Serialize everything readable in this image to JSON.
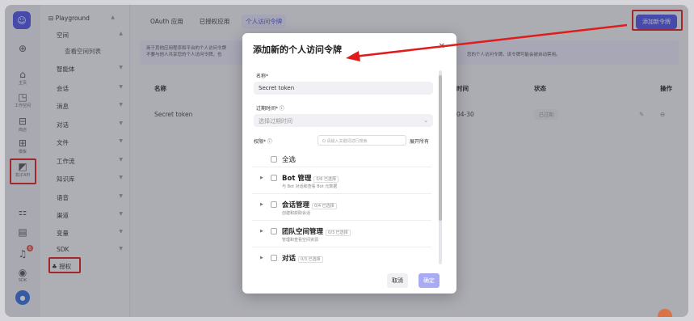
{
  "rail": {
    "items": [
      {
        "label": "主页"
      },
      {
        "label": "工作空间"
      },
      {
        "label": "商店"
      },
      {
        "label": "模板"
      },
      {
        "label": "扣子API"
      },
      {
        "label": "SDK"
      }
    ],
    "notification_count": "6"
  },
  "sidebar": {
    "title": "Playground",
    "items": [
      {
        "label": "空间"
      },
      {
        "label": "查看空间列表"
      },
      {
        "label": "智能体"
      },
      {
        "label": "会话"
      },
      {
        "label": "消息"
      },
      {
        "label": "对话"
      },
      {
        "label": "文件"
      },
      {
        "label": "工作流"
      },
      {
        "label": "知识库"
      },
      {
        "label": "语音"
      },
      {
        "label": "渠道"
      },
      {
        "label": "变量"
      },
      {
        "label": "SDK"
      },
      {
        "label": "授权"
      }
    ]
  },
  "main": {
    "tabs": [
      {
        "label": "OAuth 应用"
      },
      {
        "label": "已授权应用"
      },
      {
        "label": "个人访问令牌"
      }
    ],
    "add_button": "添加新令牌",
    "notice_line1": "用于其他应用程序和平台的个人访问令牌",
    "notice_line2": "不要与他人共享您的个人访问令牌，也",
    "notice_right": "您的个人访问令牌。该令牌可能会被自动禁用。",
    "columns": {
      "name": "名称",
      "time": "时间",
      "status": "状态",
      "actions": "操作"
    },
    "row": {
      "name": "Secret token",
      "time": "04-30",
      "status": "已过期"
    }
  },
  "modal": {
    "title": "添加新的个人访问令牌",
    "name_label": "名称*",
    "name_value": "Secret token",
    "expire_label": "过期时间* ⓘ",
    "expire_placeholder": "选择过期时间",
    "perm_label": "权限* ⓘ",
    "search_placeholder": "请输入关键词进行搜索",
    "expand_all": "展开所有",
    "select_all": "全选",
    "permissions": [
      {
        "name": "Bot 管理",
        "count": "0/6 已选择",
        "desc": "与 Bot 对话和查看 Bot 元数据"
      },
      {
        "name": "会话管理",
        "count": "0/4 已选择",
        "desc": "创建和获取会话"
      },
      {
        "name": "团队空间管理",
        "count": "0/3 已选择",
        "desc": "管理和查看空间资源"
      },
      {
        "name": "对话",
        "count": "0/3 已选择",
        "desc": ""
      }
    ],
    "cancel": "取消",
    "confirm": "确定"
  },
  "colors": {
    "accent": "#4d53e8",
    "highlight": "#e01b1b"
  }
}
